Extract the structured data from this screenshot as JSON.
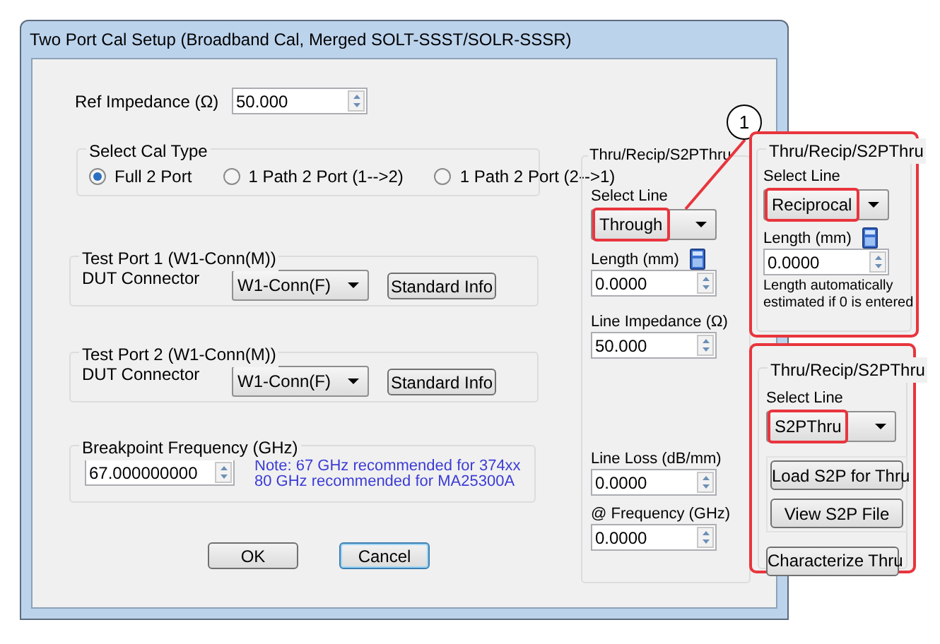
{
  "window": {
    "title": "Two Port Cal Setup (Broadband Cal, Merged SOLT-SSST/SOLR-SSSR)"
  },
  "ref_impedance": {
    "label": "Ref Impedance (Ω)",
    "value": "50.000"
  },
  "cal_type": {
    "title": "Select Cal Type",
    "options": [
      {
        "label": "Full 2 Port",
        "selected": true
      },
      {
        "label": "1 Path 2 Port (1-->2)",
        "selected": false
      },
      {
        "label": "1 Path 2 Port (2-->1)",
        "selected": false
      }
    ]
  },
  "test_ports": [
    {
      "title": "Test Port 1 (W1-Conn(M))",
      "connector_label": "DUT Connector",
      "connector_value": "W1-Conn(F)",
      "button": "Standard Info"
    },
    {
      "title": "Test Port 2 (W1-Conn(M))",
      "connector_label": "DUT Connector",
      "connector_value": "W1-Conn(F)",
      "button": "Standard Info"
    }
  ],
  "breakpoint": {
    "title": "Breakpoint Frequency (GHz)",
    "value": "67.000000000",
    "note": [
      "Note: 67 GHz recommended for 374xx",
      "80 GHz recommended for MA25300A"
    ]
  },
  "buttons": [
    {
      "label": "OK",
      "focused": false
    },
    {
      "label": "Cancel",
      "focused": true
    }
  ],
  "thru_panel": {
    "title": "Thru/Recip/S2PThru",
    "select_label": "Select Line",
    "select_value": "Through",
    "highlighted": true,
    "length_label": "Length (mm)",
    "length_value": "0.0000",
    "impedance_label": "Line Impedance (Ω)",
    "impedance_value": "50.000",
    "loss_label": "Line Loss (dB/mm)",
    "loss_value": "0.0000",
    "frequency_label": "@ Frequency (GHz)",
    "frequency_value": "0.0000"
  },
  "callout_marker": "1",
  "callouts": [
    {
      "kind": "length",
      "title": "Thru/Recip/S2PThru",
      "select_label": "Select Line",
      "select_value": "Reciprocal",
      "highlighted": true,
      "length_label": "Length (mm)",
      "length_value": "0.0000",
      "note": "Length automatically estimated if 0 is entered"
    },
    {
      "kind": "s2p",
      "title": "Thru/Recip/S2PThru",
      "select_label": "Select Line",
      "select_value": "S2PThru",
      "highlighted": true,
      "buttons": [
        "Load S2P for Thru",
        "View S2P File"
      ],
      "extra_button": "Characterize Thru"
    }
  ]
}
